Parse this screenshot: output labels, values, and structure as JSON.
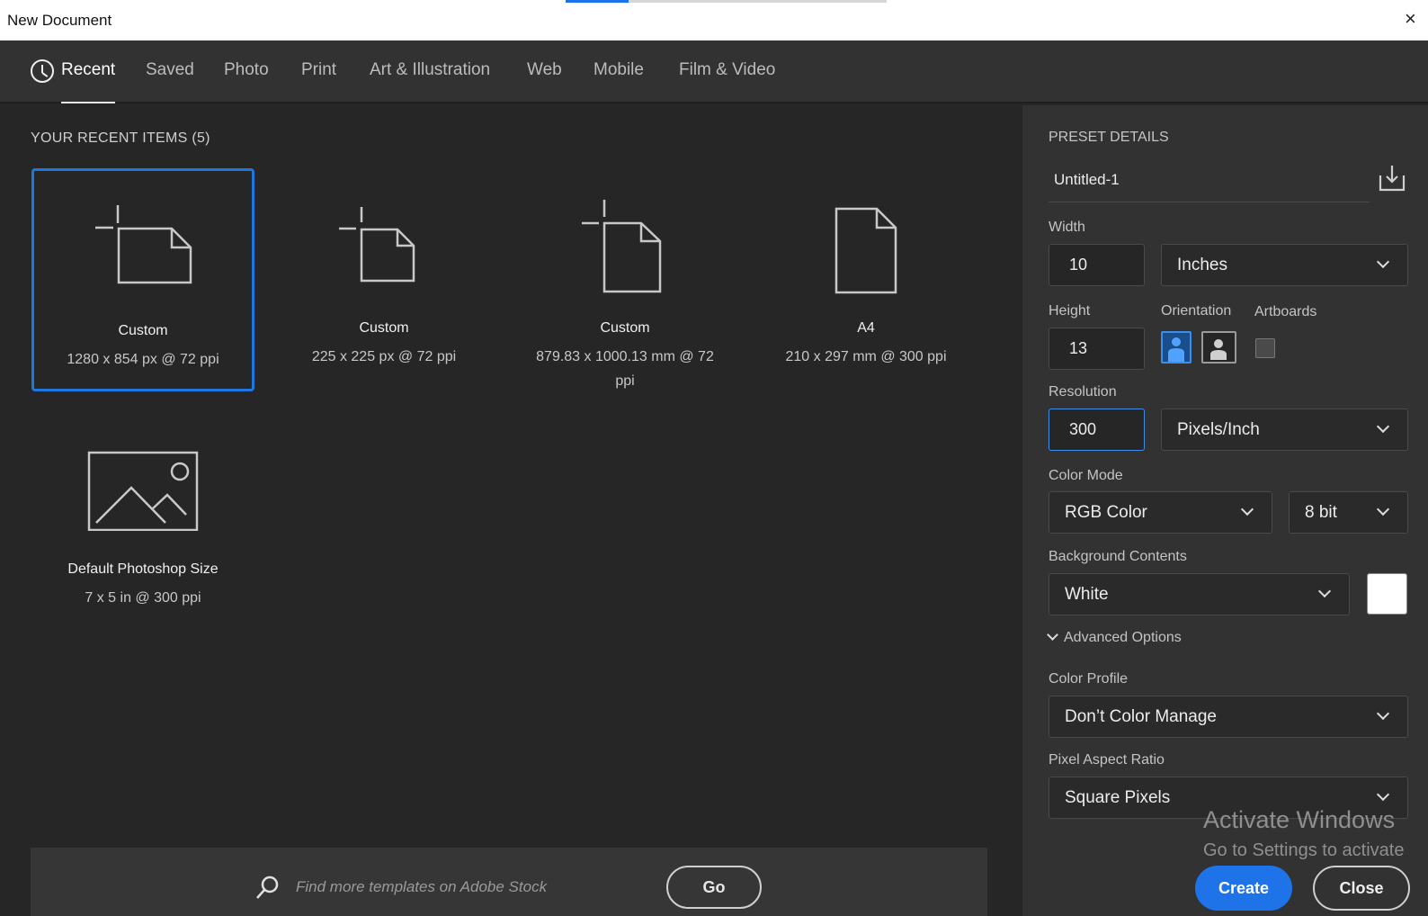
{
  "window": {
    "title": "New Document",
    "close_glyph": "×"
  },
  "tabs": [
    {
      "label": "Recent",
      "icon": "clock-icon"
    },
    {
      "label": "Saved"
    },
    {
      "label": "Photo"
    },
    {
      "label": "Print"
    },
    {
      "label": "Art & Illustration"
    },
    {
      "label": "Web"
    },
    {
      "label": "Mobile"
    },
    {
      "label": "Film & Video"
    }
  ],
  "recent": {
    "heading": "YOUR RECENT ITEMS",
    "count": "(5)",
    "items": [
      {
        "name": "Custom",
        "dims": "1280 x 854 px @ 72 ppi",
        "icon": "custom-landscape-doc-icon"
      },
      {
        "name": "Custom",
        "dims": "225 x 225 px @ 72 ppi",
        "icon": "custom-square-doc-icon"
      },
      {
        "name": "Custom",
        "dims": "879.83 x 1000.13 mm @ 72 ppi",
        "icon": "custom-portrait-doc-icon"
      },
      {
        "name": "A4",
        "dims": "210 x 297 mm @ 300 ppi",
        "icon": "portrait-doc-icon"
      },
      {
        "name": "Default Photoshop Size",
        "dims": "7 x 5 in @ 300 ppi",
        "icon": "image-icon"
      }
    ]
  },
  "stock": {
    "placeholder": "Find more templates on Adobe Stock",
    "go_label": "Go"
  },
  "preset": {
    "heading": "PRESET DETAILS",
    "name": "Untitled-1",
    "width_label": "Width",
    "width_value": "10",
    "width_unit": "Inches",
    "height_label": "Height",
    "height_value": "13",
    "orientation_label": "Orientation",
    "artboards_label": "Artboards",
    "resolution_label": "Resolution",
    "resolution_value": "300",
    "resolution_unit": "Pixels/Inch",
    "color_mode_label": "Color Mode",
    "color_mode": "RGB Color",
    "bit_depth": "8 bit",
    "background_label": "Background Contents",
    "background": "White",
    "background_color": "#ffffff",
    "advanced_label": "Advanced Options",
    "color_profile_label": "Color Profile",
    "color_profile": "Don’t Color Manage",
    "pixel_aspect_label": "Pixel Aspect Ratio",
    "pixel_aspect": "Square Pixels"
  },
  "actions": {
    "create_label": "Create",
    "close_label": "Close"
  },
  "watermark": {
    "line1": "Activate Windows",
    "line2": "Go to Settings to activate"
  },
  "colors": {
    "accent": "#1f73e8",
    "panel": "#323232",
    "background": "#262626"
  }
}
